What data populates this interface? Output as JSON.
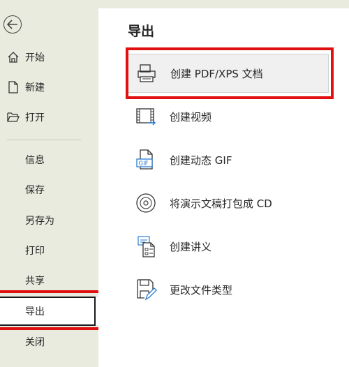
{
  "sidebar": {
    "back_icon": "back-arrow-icon",
    "items": [
      {
        "label": "开始",
        "icon": "home-icon"
      },
      {
        "label": "新建",
        "icon": "new-document-icon"
      },
      {
        "label": "打开",
        "icon": "open-folder-icon"
      },
      {
        "label": "信息"
      },
      {
        "label": "保存"
      },
      {
        "label": "另存为"
      },
      {
        "label": "打印"
      },
      {
        "label": "共享"
      },
      {
        "label": "导出",
        "selected": true
      },
      {
        "label": "关闭"
      }
    ]
  },
  "main": {
    "title": "导出",
    "options": [
      {
        "label": "创建 PDF/XPS 文档",
        "icon": "pdf-document-icon",
        "highlighted": true
      },
      {
        "label": "创建视频",
        "icon": "video-icon"
      },
      {
        "label": "创建动态 GIF",
        "icon": "gif-icon"
      },
      {
        "label": "将演示文稿打包成 CD",
        "icon": "cd-icon"
      },
      {
        "label": "创建讲义",
        "icon": "handout-icon"
      },
      {
        "label": "更改文件类型",
        "icon": "change-file-type-icon"
      }
    ]
  },
  "colors": {
    "sidebar_bg": "#e9ebdf",
    "highlight_red": "#e01010",
    "text": "#262626"
  }
}
